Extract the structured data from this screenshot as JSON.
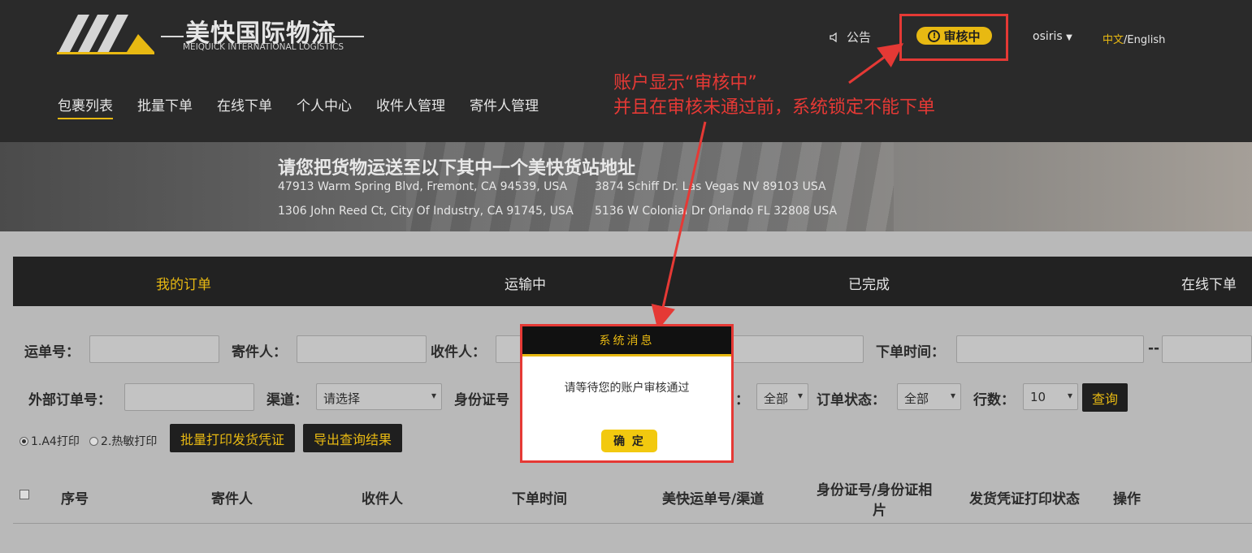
{
  "header": {
    "logo_cn": "美快国际物流",
    "logo_en": "MEIQUICK INTERNATIONAL LOGISTICS",
    "notice": "公告",
    "status": "审核中",
    "user": "osiris",
    "lang_cn": "中文",
    "lang_sep": "/",
    "lang_en": "English"
  },
  "nav": [
    "包裹列表",
    "批量下单",
    "在线下单",
    "个人中心",
    "收件人管理",
    "寄件人管理"
  ],
  "annotation": {
    "line1": "账户显示“审核中”",
    "line2": "并且在审核未通过前，系统锁定不能下单"
  },
  "banner": {
    "title": "请您把货物运送至以下其中一个美快货站地址",
    "addresses": [
      "47913 Warm Spring Blvd, Fremont, CA 94539, USA",
      "3874 Schiff Dr. Las Vegas NV 89103 USA",
      "1306 John Reed Ct, City Of Industry, CA 91745, USA",
      "5136 W Colonial Dr Orlando FL 32808 USA"
    ]
  },
  "tabs": [
    "我的订单",
    "运输中",
    "已完成",
    "在线下单"
  ],
  "filters": {
    "waybill": "运单号：",
    "sender": "寄件人：",
    "receiver": "收件人：",
    "order_time": "下单时间：",
    "time_sep": "--",
    "external_no": "外部订单号：",
    "channel": "渠道：",
    "channel_value": "请选择",
    "id_no": "身份证号",
    "print_value": "全部",
    "order_status": "订单状态：",
    "order_status_value": "全部",
    "rows": "行数：",
    "rows_value": "10",
    "query": "查询",
    "print_a4": "1.A4打印",
    "print_thermal": "2.热敏打印",
    "batch_print": "批量打印发货凭证",
    "export": "导出查询结果"
  },
  "table": {
    "columns": [
      "序号",
      "寄件人",
      "收件人",
      "下单时间",
      "美快运单号/渠道",
      "身份证号/身份证相",
      "片",
      "发货凭证打印状态",
      "操作"
    ]
  },
  "modal": {
    "title": "系统消息",
    "message": "请等待您的账户审核通过",
    "ok": "确 定"
  },
  "colors": {
    "accent": "#e8b912",
    "annotation": "#e53935",
    "header_bg": "#2a2a2a"
  }
}
